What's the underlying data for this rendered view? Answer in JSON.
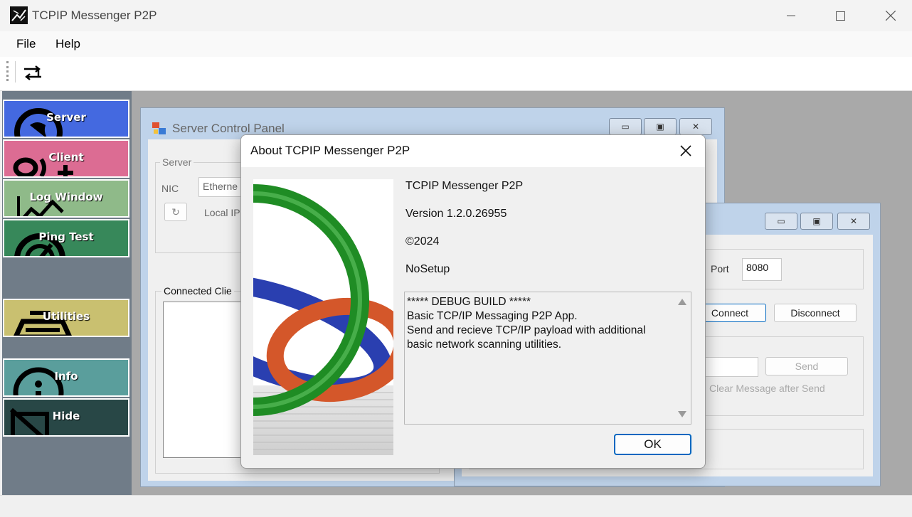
{
  "window": {
    "title": "TCPIP Messenger P2P",
    "minimize_icon": "minimize-icon",
    "maximize_icon": "maximize-icon",
    "close_icon": "close-icon"
  },
  "menu": {
    "file": "File",
    "help": "Help"
  },
  "toolbar": {
    "cascade_icon": "window-switch-icon"
  },
  "sidebar": {
    "items": [
      {
        "label": "Server",
        "color": "#4469e0",
        "icon": "globe-icon"
      },
      {
        "label": "Client",
        "color": "#dc6c93",
        "icon": "user-add-icon"
      },
      {
        "label": "Log Window",
        "color": "#8fba89",
        "icon": "chart-icon"
      },
      {
        "label": "Ping Test",
        "color": "#37885a",
        "icon": "gauge-icon"
      },
      {
        "label": "Utilities",
        "color": "#c9c070",
        "icon": "toolbox-icon"
      },
      {
        "label": "Info",
        "color": "#5a9e9c",
        "icon": "info-icon"
      },
      {
        "label": "Hide",
        "color": "#284746",
        "icon": "hide-icon"
      }
    ]
  },
  "server_panel": {
    "title": "Server Control Panel",
    "group_server": "Server",
    "nic_label": "NIC",
    "nic_value": "Etherne",
    "local_ip_label": "Local IP",
    "connected_label": "Connected Clie"
  },
  "client_panel": {
    "port_label": "Port",
    "port_value": "8080",
    "connect_label": "Connect",
    "disconnect_label": "Disconnect",
    "send_label": "Send",
    "clear_label": "Clear Message after Send"
  },
  "about_dialog": {
    "title": "About TCPIP Messenger P2P",
    "product": "TCPIP Messenger P2P",
    "version": "Version 1.2.0.26955",
    "copyright": "©2024",
    "company": "NoSetup",
    "description": "***** DEBUG BUILD *****\nBasic TCP/IP Messaging P2P App.\nSend and recieve TCP/IP payload with additional basic network scanning utilities.",
    "ok_label": "OK"
  }
}
